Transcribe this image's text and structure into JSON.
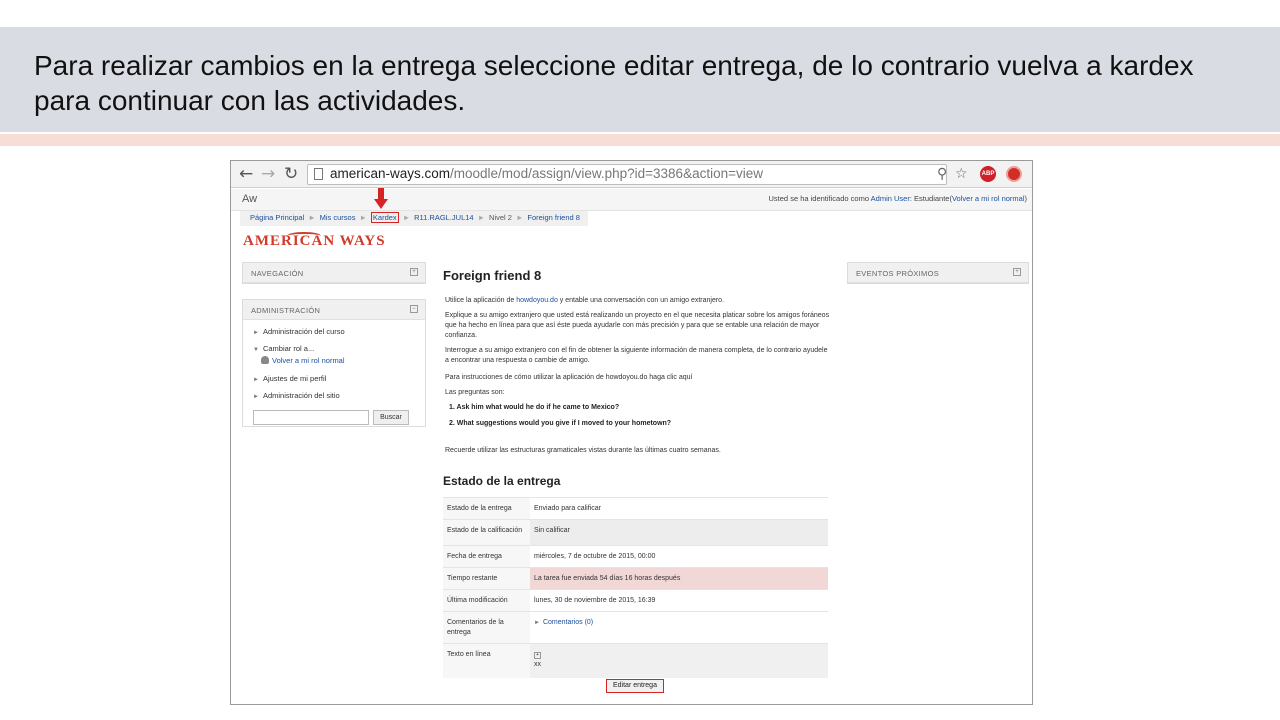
{
  "slide": {
    "title": "Para realizar cambios en la entrega seleccione editar entrega, de lo contrario vuelva a kardex para continuar con las actividades."
  },
  "browser": {
    "url_domain": "american-ways.com",
    "url_path": "/moodle/mod/assign/view.php?id=3386&action=view",
    "abp_label": "ABP"
  },
  "moodle": {
    "site_short": "Aw",
    "login_prefix": "Usted se ha identificado como",
    "user_name": "Admin User",
    "role": ": Estudiante(",
    "back_role": "Volver a mi rol normal",
    "role_close": ")"
  },
  "breadcrumb": [
    "Página Principal",
    "Mis cursos",
    "Kardex",
    "R11.RAGL.JUL14",
    "Nivel 2",
    "Foreign friend 8"
  ],
  "logo": "AMERICAN WAYS",
  "blocks": {
    "navigation": "NAVEGACIÓN",
    "administration": "ADMINISTRACIÓN",
    "events": "EVENTOS PRÓXIMOS"
  },
  "admin_menu": {
    "course_admin": "Administración del curso",
    "change_role": "Cambiar rol a...",
    "back_normal": "Volver a mi rol normal",
    "profile": "Ajustes de mi perfil",
    "site_admin": "Administración del sitio",
    "search_button": "Buscar"
  },
  "assignment": {
    "title": "Foreign friend 8",
    "p1_pre": "Utilice la aplicación de ",
    "p1_link": "howdoyou.do",
    "p1_post": " y entable una conversación con un amigo extranjero.",
    "p2": "Explique a su amigo extranjero que usted está realizando un proyecto en el que necesita platicar sobre los amigos foráneos que ha hecho en línea para que así éste pueda ayudarle con más precisión y para que se entable una relación de mayor confianza.",
    "p3": "Interrogue a su amigo extranjero con el fin de obtener la siguiente información de manera completa, de lo contrario ayudele a encontrar una respuesta o cambie de amigo.",
    "p4": "Para instrucciones de cómo utilizar la aplicación de howdoyou.do haga clic aquí",
    "p5": "Las preguntas son:",
    "q1": "1.  Ask him what would he do if he came to Mexico?",
    "q2": "2.  What suggestions would you give if I moved to your hometown?",
    "p6": "Recuerde utilizar las estructuras gramaticales vistas durante las últimas cuatro semanas."
  },
  "status": {
    "heading": "Estado de la entrega",
    "rows": [
      {
        "label": "Estado de la entrega",
        "value": "Enviado para calificar"
      },
      {
        "label": "Estado de la calificación",
        "value": "Sin calificar"
      },
      {
        "label": "Fecha de entrega",
        "value": "miércoles, 7 de octubre de 2015, 00:00"
      },
      {
        "label": "Tiempo restante",
        "value": "La tarea fue enviada 54 días 16 horas después"
      },
      {
        "label": "Última modificación",
        "value": "lunes, 30 de noviembre de 2015, 16:39"
      },
      {
        "label": "Comentarios de la entrega",
        "value": "Comentarios (0)"
      },
      {
        "label": "Texto en línea",
        "value": "xx"
      }
    ],
    "edit_button": "Editar entrega"
  },
  "colors": {
    "highlight_red": "#d62424",
    "link_blue": "#1a4f9c",
    "header_band": "#d9dde3"
  }
}
